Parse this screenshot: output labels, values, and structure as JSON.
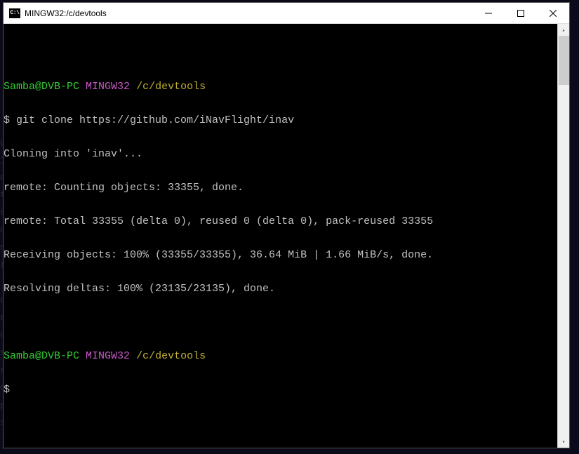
{
  "titlebar": {
    "icon_text": "C:\\",
    "title": "MINGW32:/c/devtools"
  },
  "prompt1": {
    "user": "Samba@DVB-PC",
    "mingw": "MINGW32",
    "path": "/c/devtools"
  },
  "command": "$ git clone https://github.com/iNavFlight/inav",
  "output": {
    "l1": "Cloning into 'inav'...",
    "l2": "remote: Counting objects: 33355, done.",
    "l3": "remote: Total 33355 (delta 0), reused 0 (delta 0), pack-reused 33355",
    "l4": "Receiving objects: 100% (33355/33355), 36.64 MiB | 1.66 MiB/s, done.",
    "l5": "Resolving deltas: 100% (23135/23135), done."
  },
  "prompt2": {
    "user": "Samba@DVB-PC",
    "mingw": "MINGW32",
    "path": "/c/devtools",
    "dollar": "$"
  },
  "scrollbar": {
    "up": "▴",
    "down": "▾"
  }
}
